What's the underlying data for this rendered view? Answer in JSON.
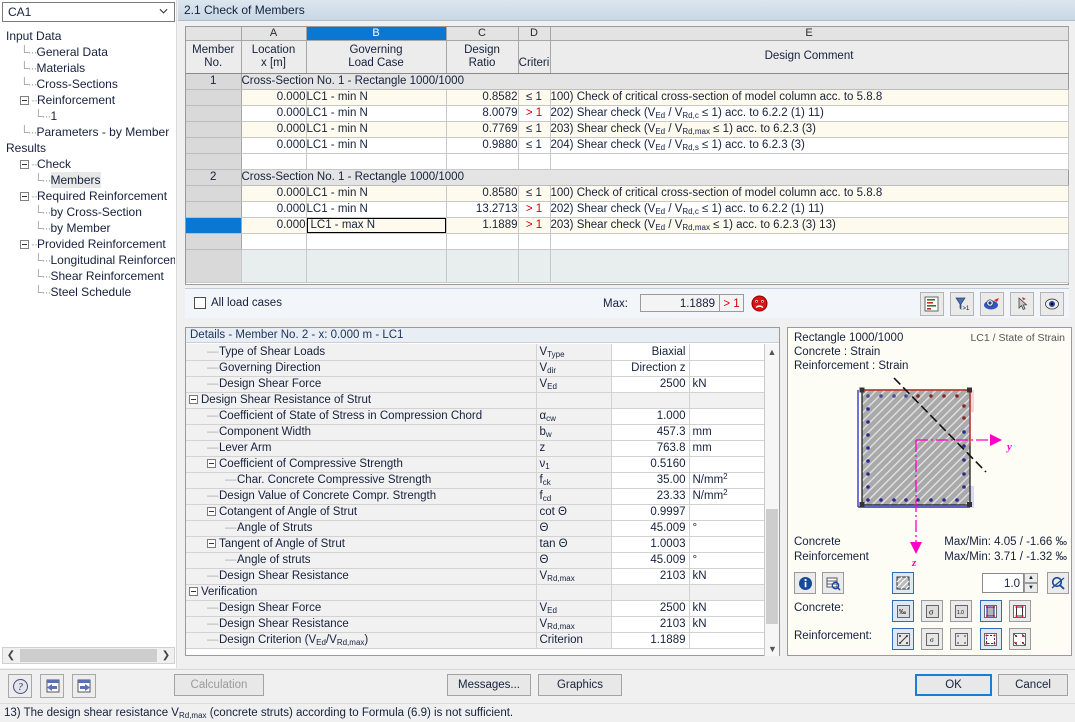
{
  "window": {
    "title": "2.1 Check of Members"
  },
  "sidebar": {
    "selector_value": "CA1",
    "tree": [
      {
        "label": "Input Data",
        "level": 0,
        "marker": "none"
      },
      {
        "label": "General Data",
        "level": 1,
        "marker": "leaf"
      },
      {
        "label": "Materials",
        "level": 1,
        "marker": "leaf"
      },
      {
        "label": "Cross-Sections",
        "level": 1,
        "marker": "leaf"
      },
      {
        "label": "Reinforcement",
        "level": 1,
        "marker": "expanded"
      },
      {
        "label": "1",
        "level": 2,
        "marker": "leaf"
      },
      {
        "label": "Parameters - by Member",
        "level": 1,
        "marker": "leaf"
      },
      {
        "label": "Results",
        "level": 0,
        "marker": "none"
      },
      {
        "label": "Check",
        "level": 1,
        "marker": "expanded"
      },
      {
        "label": "Members",
        "level": 2,
        "marker": "leaf",
        "selected": true
      },
      {
        "label": "Required Reinforcement",
        "level": 1,
        "marker": "expanded"
      },
      {
        "label": "by Cross-Section",
        "level": 2,
        "marker": "leaf"
      },
      {
        "label": "by Member",
        "level": 2,
        "marker": "leaf"
      },
      {
        "label": "Provided Reinforcement",
        "level": 1,
        "marker": "expanded"
      },
      {
        "label": "Longitudinal Reinforcement",
        "level": 2,
        "marker": "leaf"
      },
      {
        "label": "Shear Reinforcement",
        "level": 2,
        "marker": "leaf"
      },
      {
        "label": "Steel Schedule",
        "level": 2,
        "marker": "leaf"
      }
    ]
  },
  "grid": {
    "column_letters": [
      "A",
      "B",
      "C",
      "D",
      "E"
    ],
    "active_column": "B",
    "headers": {
      "member": [
        "Member",
        "No."
      ],
      "a": [
        "Location",
        "x [m]"
      ],
      "b": [
        "Governing",
        "Load Case"
      ],
      "c": [
        "Design",
        "Ratio"
      ],
      "d": [
        "",
        "Criteri"
      ],
      "e": "Design Comment"
    },
    "groups": [
      {
        "member_no": "1",
        "caption": "Cross-Section No. 1 - Rectangle 1000/1000",
        "rows": [
          {
            "location": "0.000",
            "load_case": "LC1 - min N",
            "ratio": "0.8582",
            "criterion": "≤ 1",
            "over": false,
            "comment_num": "100)",
            "comment": "Check of critical cross-section of model column acc. to 5.8.8"
          },
          {
            "location": "0.000",
            "load_case": "LC1 - min N",
            "ratio": "8.0079",
            "criterion": "> 1",
            "over": true,
            "comment_num": "202)",
            "comment_pre": "Shear check (V",
            "comment_sub1": "Ed",
            "comment_mid": " / V",
            "comment_sub2": "Rd,c",
            "comment_post": " ≤ 1) acc. to 6.2.2 (1) 11)"
          },
          {
            "location": "0.000",
            "load_case": "LC1 - min N",
            "ratio": "0.7769",
            "criterion": "≤ 1",
            "over": false,
            "comment_num": "203)",
            "comment_pre": "Shear check  (V",
            "comment_sub1": "Ed",
            "comment_mid": " / V",
            "comment_sub2": "Rd,max",
            "comment_post": " ≤ 1) acc. to 6.2.3 (3)"
          },
          {
            "location": "0.000",
            "load_case": "LC1 - min N",
            "ratio": "0.9880",
            "criterion": "≤ 1",
            "over": false,
            "comment_num": "204)",
            "comment_pre": "Shear check (V",
            "comment_sub1": "Ed",
            "comment_mid": " / V",
            "comment_sub2": "Rd,s",
            "comment_post": " ≤ 1) acc. to 6.2.3 (3)"
          }
        ]
      },
      {
        "member_no": "2",
        "caption": "Cross-Section No. 1 - Rectangle 1000/1000",
        "rows": [
          {
            "location": "0.000",
            "load_case": "LC1 - min N",
            "ratio": "0.8580",
            "criterion": "≤ 1",
            "over": false,
            "comment_num": "100)",
            "comment": "Check of critical cross-section of model column acc. to 5.8.8"
          },
          {
            "location": "0.000",
            "load_case": "LC1 - min N",
            "ratio": "13.2713",
            "criterion": "> 1",
            "over": true,
            "comment_num": "202)",
            "comment_pre": "Shear check (V",
            "comment_sub1": "Ed",
            "comment_mid": " / V",
            "comment_sub2": "Rd,c",
            "comment_post": " ≤ 1) acc. to 6.2.2 (1) 11)"
          },
          {
            "location": "0.000",
            "load_case": "LC1 - max N",
            "ratio": "1.1889",
            "criterion": "> 1",
            "over": true,
            "selected": true,
            "comment_num": "203)",
            "comment_pre": "Shear check  (V",
            "comment_sub1": "Ed",
            "comment_mid": " / V",
            "comment_sub2": "Rd,max",
            "comment_post": " ≤ 1) acc. to 6.2.3 (3) 13)"
          }
        ]
      }
    ],
    "footer": {
      "all_load_cases_label": "All load cases",
      "all_load_cases_checked": false,
      "max_label": "Max:",
      "max_value": "1.1889",
      "max_criterion": "> 1",
      "status_icon": "sad-face-icon"
    },
    "toolbar_icons": [
      "chart-bars-icon",
      "filter-gt1-icon",
      "view-colored-icon",
      "pointer-select-icon",
      "eye-icon"
    ]
  },
  "details": {
    "title": "Details  -  Member No. 2  -  x: 0.000 m  -  LC1",
    "rows": [
      {
        "name": "Type of Shear Loads",
        "indent": 2,
        "marker": "dash",
        "sym": "V",
        "sym_sub": "Type",
        "value": "Biaxial",
        "unit": "",
        "value_align": "right"
      },
      {
        "name": "Governing Direction",
        "indent": 2,
        "marker": "dash",
        "sym": "V",
        "sym_sub": "dir",
        "value": "Direction z",
        "unit": ""
      },
      {
        "name": "Design Shear Force",
        "indent": 2,
        "marker": "dash",
        "sym": "V",
        "sym_sub": "Ed",
        "value": "2500",
        "unit": "kN"
      },
      {
        "name": "Design Shear Resistance of Strut",
        "indent": 0,
        "marker": "minus",
        "sym": "",
        "value": "",
        "unit": "",
        "group": true
      },
      {
        "name": "Coefficient of State of Stress in Compression Chord",
        "indent": 2,
        "marker": "dash",
        "sym": "α",
        "sym_sub": "cw",
        "value": "1.000",
        "unit": ""
      },
      {
        "name": "Component Width",
        "indent": 2,
        "marker": "dash",
        "sym": "b",
        "sym_sub": "w",
        "value": "457.3",
        "unit": "mm"
      },
      {
        "name": "Lever Arm",
        "indent": 2,
        "marker": "dash",
        "sym": "z",
        "sym_sub": "",
        "value": "763.8",
        "unit": "mm"
      },
      {
        "name": "Coefficient of Compressive Strength",
        "indent": 2,
        "marker": "minus",
        "sym": "ν",
        "sym_sub": "1",
        "value": "0.5160",
        "unit": ""
      },
      {
        "name": "Char. Concrete Compressive Strength",
        "indent": 4,
        "marker": "dash",
        "sym": "f",
        "sym_sub": "ck",
        "value": "35.00",
        "unit": "N/mm2",
        "unit_sup": "2",
        "unit_base": "N/mm"
      },
      {
        "name": "Design Value of Concrete Compr. Strength",
        "indent": 2,
        "marker": "dash",
        "sym": "f",
        "sym_sub": "cd",
        "value": "23.33",
        "unit": "N/mm2",
        "unit_sup": "2",
        "unit_base": "N/mm"
      },
      {
        "name": "Cotangent of Angle of Strut",
        "indent": 2,
        "marker": "minus",
        "sym": "cot Θ",
        "sym_sub": "",
        "value": "0.9997",
        "unit": ""
      },
      {
        "name": "Angle of Struts",
        "indent": 4,
        "marker": "dash",
        "sym": "Θ",
        "sym_sub": "",
        "value": "45.009",
        "unit": "°"
      },
      {
        "name": "Tangent of Angle of Strut",
        "indent": 2,
        "marker": "minus",
        "sym": "tan Θ",
        "sym_sub": "",
        "value": "1.0003",
        "unit": ""
      },
      {
        "name": "Angle of struts",
        "indent": 4,
        "marker": "dash",
        "sym": "Θ",
        "sym_sub": "",
        "value": "45.009",
        "unit": "°"
      },
      {
        "name": "Design Shear Resistance",
        "indent": 2,
        "marker": "dash",
        "sym": "V",
        "sym_sub": "Rd,max",
        "value": "2103",
        "unit": "kN"
      },
      {
        "name": "Verification",
        "indent": 0,
        "marker": "minus",
        "sym": "",
        "value": "",
        "unit": "",
        "group": true
      },
      {
        "name": "Design Shear Force",
        "indent": 2,
        "marker": "dash",
        "sym": "V",
        "sym_sub": "Ed",
        "value": "2500",
        "unit": "kN"
      },
      {
        "name": "Design Shear Resistance",
        "indent": 2,
        "marker": "dash",
        "sym": "V",
        "sym_sub": "Rd,max",
        "value": "2103",
        "unit": "kN"
      },
      {
        "name": "Design Criterion (VEd/VRd,max)",
        "indent": 2,
        "marker": "dash",
        "sym": "Criterion",
        "sym_sub": "",
        "value": "1.1889",
        "unit": "",
        "name_pre": "Design Criterion (V",
        "name_sub1": "Ed",
        "name_mid": "/V",
        "name_sub2": "Rd,max",
        "name_post": ")"
      }
    ]
  },
  "graphic": {
    "header_lines": [
      "Rectangle 1000/1000",
      "Concrete : Strain",
      "Reinforcement : Strain"
    ],
    "corner_label": "LC1 / State of Strain",
    "axis_y_label": "y",
    "axis_z_label": "z",
    "stats": [
      {
        "key": "Concrete",
        "value": "Max/Min: 4.05 / -1.66 ‰"
      },
      {
        "key": "Reinforcement",
        "value": "Max/Min: 3.71 / -1.32 ‰"
      }
    ],
    "zoom_value": "1.0",
    "row_labels": {
      "concrete": "Concrete:",
      "reinforcement": "Reinforcement:"
    },
    "toolbar_icons": [
      "info-icon",
      "table-search-icon",
      "hatch-fill-icon",
      "zoom-reset-icon"
    ],
    "concrete_icons": [
      "strain-permille-icon",
      "stress-sigma-icon",
      "values-icon",
      "section-outline-icon",
      "section-points-icon"
    ],
    "reinforcement_icons": [
      "rebar-strain-icon",
      "rebar-stress-icon",
      "rebar-values-icon",
      "rebar-outline-icon",
      "rebar-points-icon"
    ]
  },
  "bottom": {
    "help_icon": "help-icon",
    "prev_icon": "previous-page-icon",
    "next_icon": "next-page-icon",
    "calculation_label": "Calculation",
    "messages_label": "Messages...",
    "graphics_label": "Graphics",
    "ok_label": "OK",
    "cancel_label": "Cancel"
  },
  "statusbar": {
    "num": "13)",
    "pre": "The design shear resistance V",
    "sub1": "Rd,max",
    "post": " (concrete struts) according to Formula (6.9) is not sufficient."
  },
  "colors": {
    "accent": "#0a78d2",
    "over_limit": "#e00000",
    "row_alt": "#fefaee",
    "group_row": "#e4e4e4",
    "magenta_axis": "#ff00c8"
  }
}
